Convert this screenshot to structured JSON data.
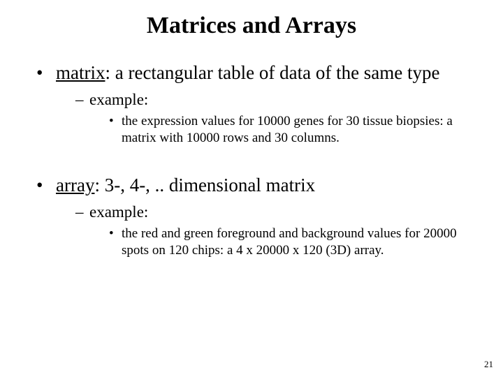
{
  "title": "Matrices and Arrays",
  "bullets": [
    {
      "term": "matrix",
      "definition": ": a rectangular table of data of the same type",
      "example_label": "example:",
      "example_text": "the expression values for 10000 genes for 30 tissue biopsies: a matrix with 10000 rows and 30 columns."
    },
    {
      "term": "array",
      "definition": ": 3-, 4-, .. dimensional matrix",
      "example_label": "example:",
      "example_text": "the red and green foreground and background values for 20000 spots on 120 chips: a 4 x 20000 x 120 (3D) array."
    }
  ],
  "page_number": "21"
}
